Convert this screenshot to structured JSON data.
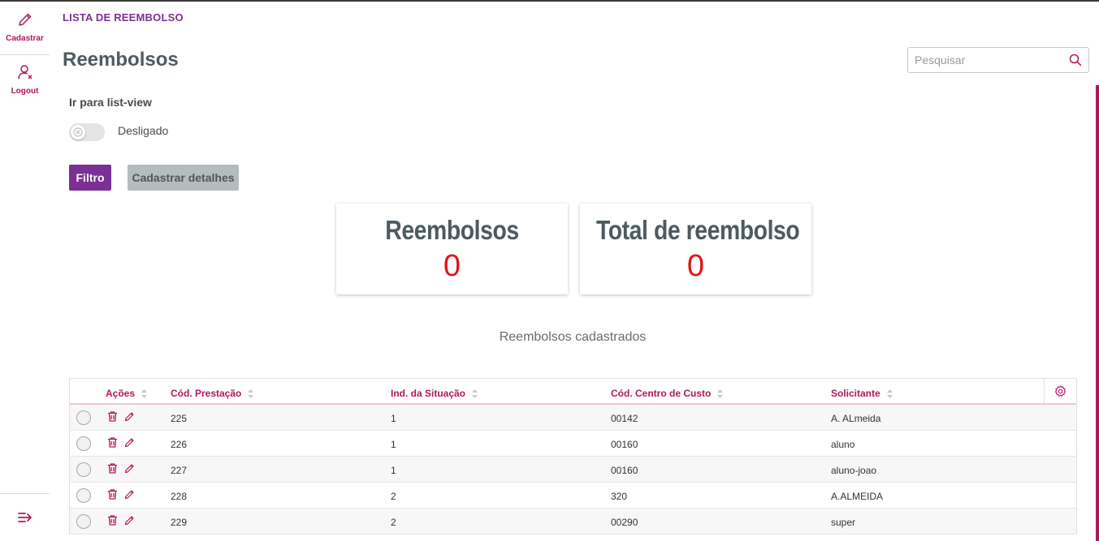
{
  "sidebar": {
    "items": [
      {
        "label": "Cadastrar",
        "icon": "pencil-icon"
      },
      {
        "label": "Logout",
        "icon": "user-logout-icon"
      }
    ],
    "footer_icon": "collapse-menu-icon"
  },
  "header": {
    "breadcrumb": "LISTA DE REEMBOLSO",
    "title": "Reembolsos",
    "search_placeholder": "Pesquisar"
  },
  "listview": {
    "title": "Ir para list-view",
    "state": "Desligado",
    "enabled": false
  },
  "buttons": {
    "filtro": "Filtro",
    "cadastrar": "Cadastrar detalhes"
  },
  "cards": [
    {
      "title": "Reembolsos",
      "value": "0"
    },
    {
      "title": "Total de reembolso",
      "value": "0"
    }
  ],
  "table": {
    "caption": "Reembolsos cadastrados",
    "columns": [
      "Ações",
      "Cód. Prestação",
      "Ind. da Situação",
      "Cód. Centro de Custo",
      "Solicitante"
    ],
    "rows": [
      {
        "cod": "225",
        "ind": "1",
        "centro": "00142",
        "solicitante": "A. ALmeida"
      },
      {
        "cod": "226",
        "ind": "1",
        "centro": "00160",
        "solicitante": "aluno"
      },
      {
        "cod": "227",
        "ind": "1",
        "centro": "00160",
        "solicitante": "aluno-joao"
      },
      {
        "cod": "228",
        "ind": "2",
        "centro": "320",
        "solicitante": "A.ALMEIDA"
      },
      {
        "cod": "229",
        "ind": "2",
        "centro": "00290",
        "solicitante": "super"
      }
    ]
  },
  "colors": {
    "accent": "#b0185e",
    "primary": "#7b3095",
    "value_red": "#e01515",
    "title_gray": "#4d5b60"
  }
}
